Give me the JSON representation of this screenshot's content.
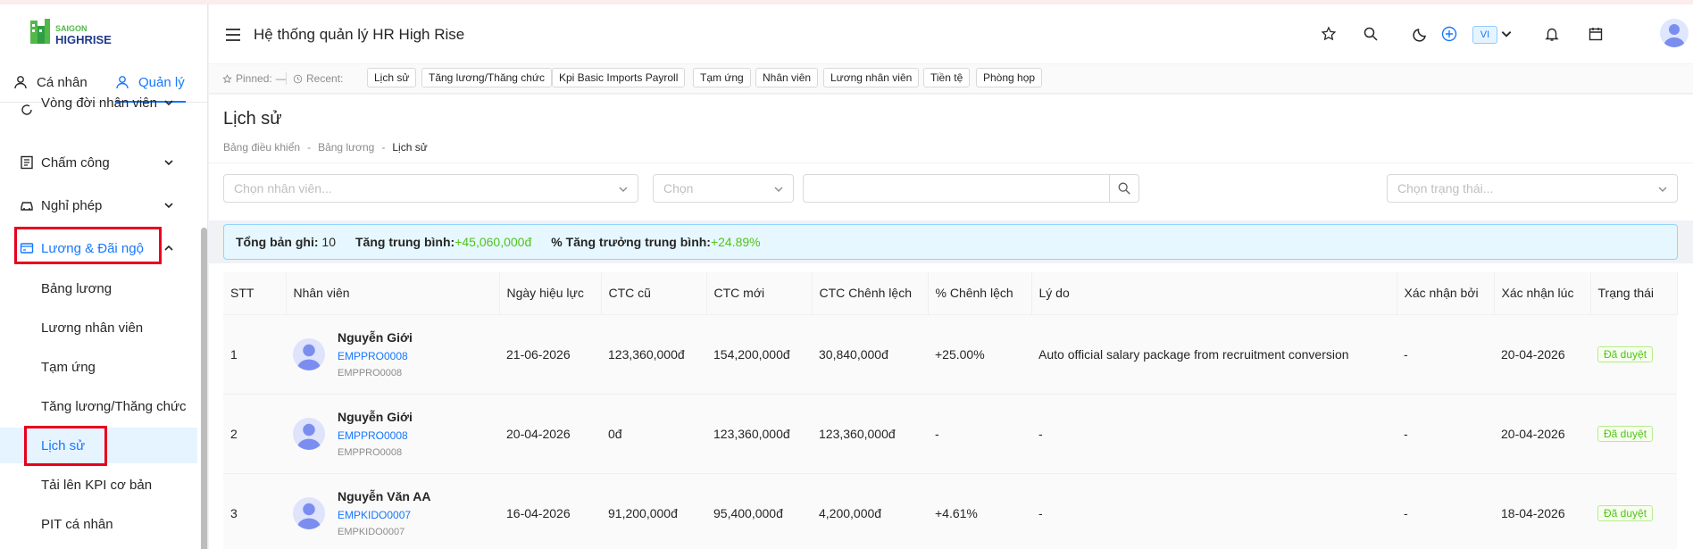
{
  "brand": {
    "line1": "SAIGON",
    "line2": "HIGHRISE"
  },
  "sidebar": {
    "modes": [
      {
        "label": "Cá nhân"
      },
      {
        "label": "Quản lý"
      }
    ],
    "menu": [
      {
        "label": "Vòng đời nhân viên"
      },
      {
        "label": "Chấm công"
      },
      {
        "label": "Nghỉ phép"
      },
      {
        "label": "Lương & Đãi ngộ"
      }
    ],
    "submenu": [
      {
        "label": "Bảng lương"
      },
      {
        "label": "Lương nhân viên"
      },
      {
        "label": "Tạm ứng"
      },
      {
        "label": "Tăng lương/Thăng chức"
      },
      {
        "label": "Lịch sử"
      },
      {
        "label": "Tải lên KPI cơ bản"
      },
      {
        "label": "PIT cá nhân"
      }
    ]
  },
  "header": {
    "title": "Hệ thống quản lý HR High Rise",
    "lang": "VI"
  },
  "recent": {
    "pinned_label": "Pinned:",
    "pinned_value": "—",
    "recent_label": "Recent:",
    "chips": [
      "Lịch sử",
      "Tăng lương/Thăng chức",
      "Kpi Basic Imports Payroll",
      "Tạm ứng",
      "Nhân viên",
      "Lương nhân viên",
      "Tiền tệ",
      "Phòng họp"
    ]
  },
  "page": {
    "title": "Lịch sử",
    "breadcrumb": [
      "Bảng điều khiển",
      "-",
      "Bảng lương",
      "-",
      "Lịch sử"
    ]
  },
  "filters": {
    "employee_placeholder": "Chọn nhân viên...",
    "choose_placeholder": "Chọn",
    "status_placeholder": "Chọn trạng thái..."
  },
  "stats": {
    "total_label": "Tổng bản ghi:",
    "total_value": "10",
    "avg_label": "Tăng trung bình:",
    "avg_value": "+45,060,000đ",
    "growth_label": "% Tăng trưởng trung bình:",
    "growth_value": "+24.89%"
  },
  "table": {
    "columns": [
      "STT",
      "Nhân viên",
      "Ngày hiệu lực",
      "CTC cũ",
      "CTC mới",
      "CTC Chênh lệch",
      "% Chênh lệch",
      "Lý do",
      "Xác nhận bởi",
      "Xác nhận lúc",
      "Trạng thái"
    ],
    "rows": [
      {
        "stt": "1",
        "name": "Nguyễn Giới",
        "code": "EMPPRO0008",
        "sub": "EMPPRO0008",
        "date": "21-06-2026",
        "old": "123,360,000đ",
        "new": "154,200,000đ",
        "diff": "30,840,000đ",
        "pct": "+25.00%",
        "reason": "Auto official salary package from recruitment conversion",
        "by": "-",
        "at": "20-04-2026",
        "status": "Đã duyệt"
      },
      {
        "stt": "2",
        "name": "Nguyễn Giới",
        "code": "EMPPRO0008",
        "sub": "EMPPRO0008",
        "date": "20-04-2026",
        "old": "0đ",
        "new": "123,360,000đ",
        "diff": "123,360,000đ",
        "pct": "-",
        "reason": "-",
        "by": "-",
        "at": "20-04-2026",
        "status": "Đã duyệt"
      },
      {
        "stt": "3",
        "name": "Nguyễn Văn AA",
        "code": "EMPKIDO0007",
        "sub": "EMPKIDO0007",
        "date": "16-04-2026",
        "old": "91,200,000đ",
        "new": "95,400,000đ",
        "diff": "4,200,000đ",
        "pct": "+4.61%",
        "reason": "-",
        "by": "-",
        "at": "18-04-2026",
        "status": "Đã duyệt"
      }
    ]
  }
}
